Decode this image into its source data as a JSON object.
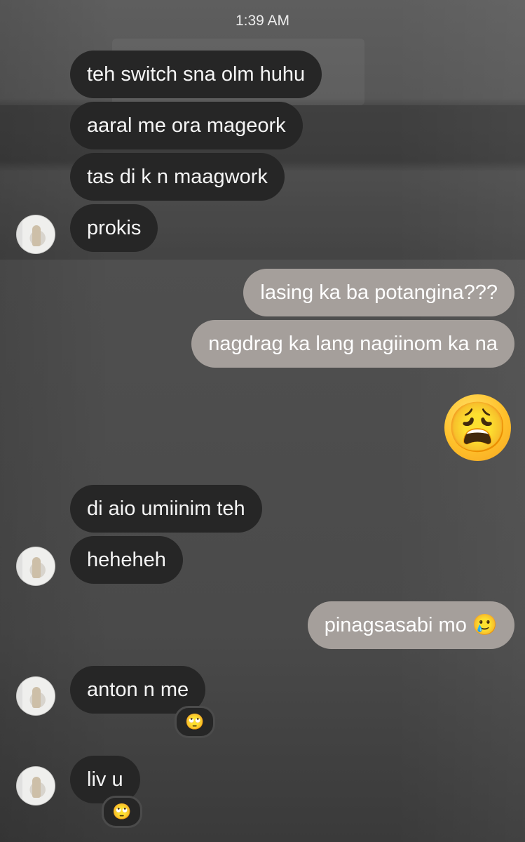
{
  "status_time": "1:39 AM",
  "messages": [
    {
      "text": "teh switch sna olm huhu"
    },
    {
      "text": "aaral me ora mageork"
    },
    {
      "text": "tas di k n maagwork"
    },
    {
      "text": "prokis"
    },
    {
      "text": "lasing ka ba potangina???"
    },
    {
      "text": "nagdrag ka lang nagiinom ka na"
    },
    {
      "text": "😩"
    },
    {
      "text": "di aio umiinim teh"
    },
    {
      "text": "heheheh"
    },
    {
      "text": "pinagsasabi mo 🥲"
    },
    {
      "text": "anton n me",
      "reaction": "🙄"
    },
    {
      "text": "liv u",
      "reaction": "🙄"
    }
  ]
}
